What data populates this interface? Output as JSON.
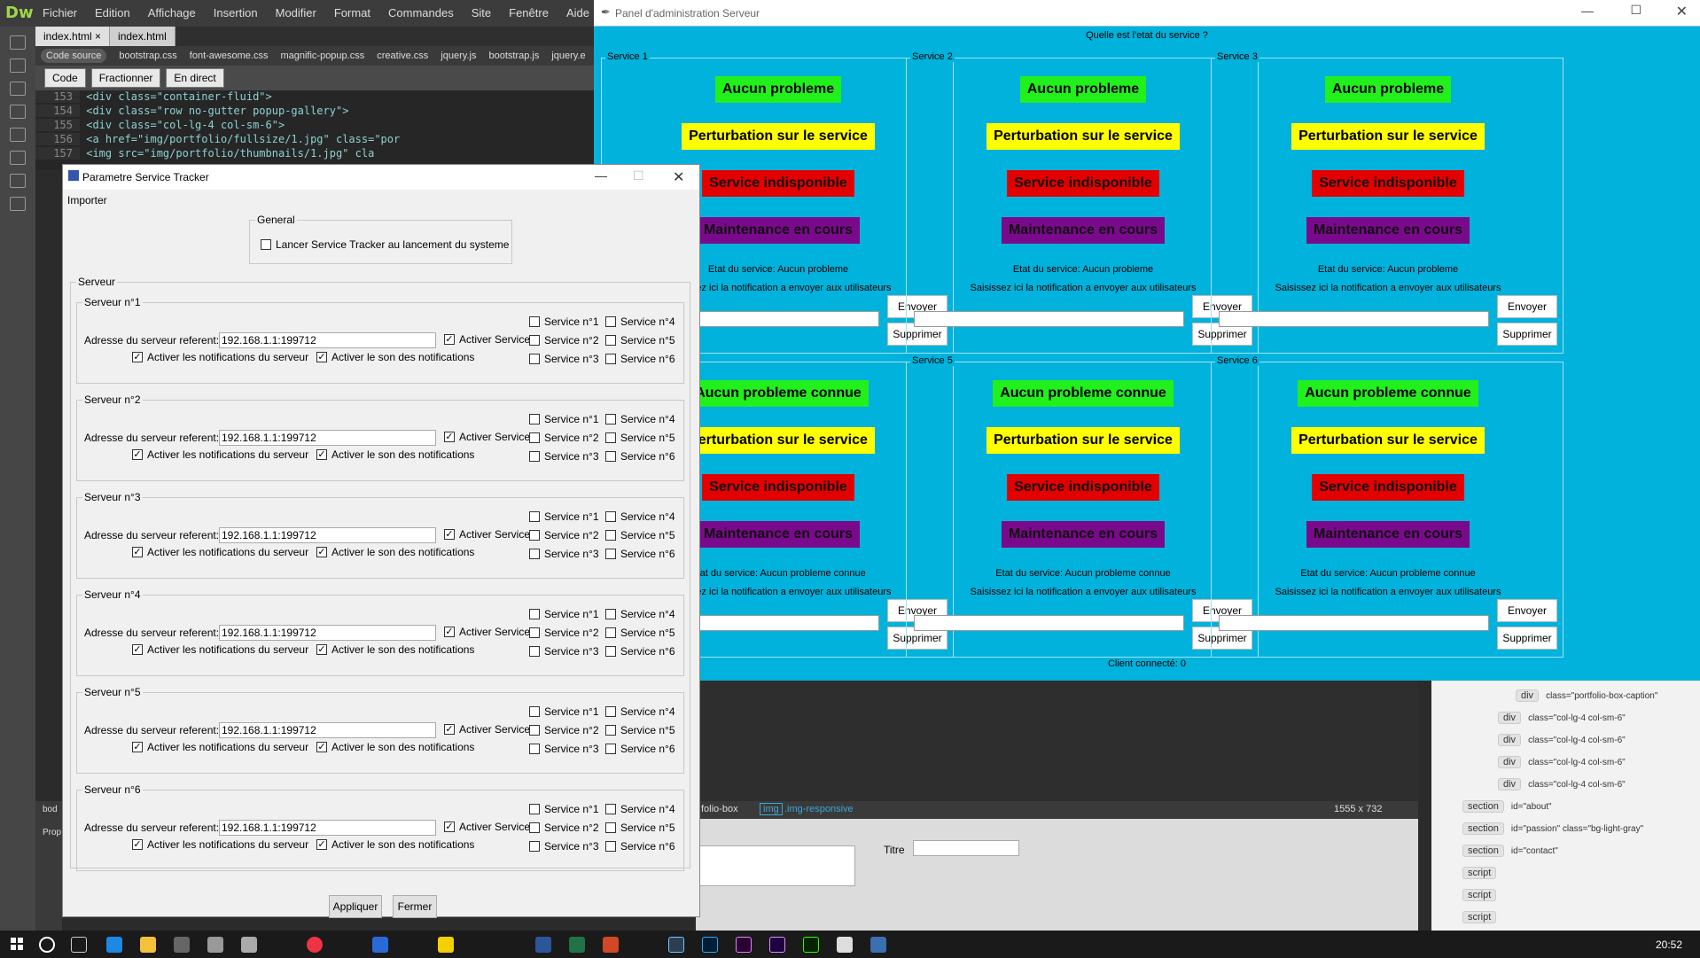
{
  "dreamweaver": {
    "logo": "Dw",
    "menu": [
      "Fichier",
      "Edition",
      "Affichage",
      "Insertion",
      "Modifier",
      "Format",
      "Commandes",
      "Site",
      "Fenêtre",
      "Aide"
    ],
    "tabs": [
      "index.html",
      "index.html"
    ],
    "files": [
      "Code source",
      "bootstrap.css",
      "font-awesome.css",
      "magnific-popup.css",
      "creative.css",
      "jquery.js",
      "bootstrap.js",
      "jquery.e"
    ],
    "view_buttons": [
      "Code",
      "Fractionner",
      "En direct"
    ],
    "code_lines": [
      {
        "num": "153",
        "text": "    <div class=\"container-fluid\">"
      },
      {
        "num": "154",
        "text": "        <div class=\"row no-gutter popup-gallery\">"
      },
      {
        "num": "155",
        "text": "            <div class=\"col-lg-4 col-sm-6\">"
      },
      {
        "num": "156",
        "text": "                <a href=\"img/portfolio/fullsize/1.jpg\" class=\"por"
      },
      {
        "num": "157",
        "text": "                    <img src=\"img/portfolio/thumbnails/1.jpg\" cla"
      }
    ],
    "status_breadcrumb_a": "folio-box",
    "status_breadcrumb_b": "img",
    "status_breadcrumb_c": ".img-responsive",
    "status_size": "1555 x 732",
    "props_title_label": "Titre",
    "body_tag": "bod",
    "props_label": "Prop",
    "dom_nodes": [
      {
        "tag": "div",
        "attr": "class=\"portfolio-box-caption\""
      },
      {
        "tag": "div",
        "attr": "class=\"col-lg-4 col-sm-6\""
      },
      {
        "tag": "div",
        "attr": "class=\"col-lg-4 col-sm-6\""
      },
      {
        "tag": "div",
        "attr": "class=\"col-lg-4 col-sm-6\""
      },
      {
        "tag": "div",
        "attr": "class=\"col-lg-4 col-sm-6\""
      },
      {
        "tag": "section",
        "attr": "id=\"about\""
      },
      {
        "tag": "section",
        "attr": "id=\"passion\" class=\"bg-light-gray\""
      },
      {
        "tag": "section",
        "attr": "id=\"contact\""
      },
      {
        "tag": "script",
        "attr": ""
      },
      {
        "tag": "script",
        "attr": ""
      },
      {
        "tag": "script",
        "attr": ""
      }
    ]
  },
  "admin_panel": {
    "title": "Panel d'administration Serveur",
    "question": "Quelle est l'etat du service ?",
    "status_labels": {
      "ok": "Aucun probleme",
      "ok_known": "Aucun probleme connue",
      "perturbation": "Perturbation sur le service",
      "down": "Service indisponible",
      "maintenance": "Maintenance en cours"
    },
    "notification_prompt": "Saisissez ici la notification a envoyer aux utilisateurs",
    "send_label": "Envoyer",
    "delete_label": "Supprimer",
    "services": [
      {
        "name": "Service 1",
        "state": "Etat du service: Aucun probleme",
        "first_status": "Aucun probleme"
      },
      {
        "name": "Service 2",
        "state": "Etat du service: Aucun probleme",
        "first_status": "Aucun probleme"
      },
      {
        "name": "Service 3",
        "state": "Etat du service: Aucun probleme",
        "first_status": "Aucun probleme"
      },
      {
        "name": "",
        "state": "Etat du service: Aucun probleme connue",
        "first_status": "Aucun probleme connue"
      },
      {
        "name": "Service 5",
        "state": "Etat du service: Aucun probleme connue",
        "first_status": "Aucun probleme connue"
      },
      {
        "name": "Service 6",
        "state": "Etat du service: Aucun probleme connue",
        "first_status": "Aucun probleme connue"
      }
    ],
    "clients": "Client connecté: 0",
    "colors": {
      "background": "#00b2dc",
      "green": "#21f01c",
      "yellow": "#ffff00",
      "red": "#e20000",
      "purple": "#7a0a8c"
    }
  },
  "dialog": {
    "title": "Parametre Service Tracker",
    "menu_import": "Importer",
    "general_group": "General",
    "launch_at_startup": "Lancer Service Tracker au lancement du systeme",
    "server_group": "Serveur",
    "address_label": "Adresse du serveur referent:",
    "activate_service": "Activer Service",
    "activate_notifications": "Activer les notifications du serveur",
    "activate_sound": "Activer le son des notifications",
    "service_checks": [
      "Service n°1",
      "Service n°4",
      "Service n°2",
      "Service n°5",
      "Service n°3",
      "Service n°6"
    ],
    "servers": [
      {
        "name": "Serveur n°1",
        "address": "192.168.1.1:199712"
      },
      {
        "name": "Serveur n°2",
        "address": "192.168.1.1:199712"
      },
      {
        "name": "Serveur n°3",
        "address": "192.168.1.1:199712"
      },
      {
        "name": "Serveur n°4",
        "address": "192.168.1.1:199712"
      },
      {
        "name": "Serveur n°5",
        "address": "192.168.1.1:199712"
      },
      {
        "name": "Serveur n°6",
        "address": "192.168.1.1:199712"
      }
    ],
    "apply": "Appliquer",
    "close": "Fermer"
  },
  "taskbar": {
    "time": "20:52"
  }
}
